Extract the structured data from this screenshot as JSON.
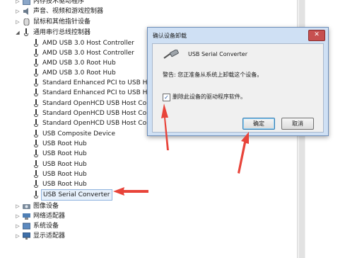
{
  "tree": {
    "top_items": [
      {
        "label": "内存技术驱动程序",
        "expander": "▷"
      },
      {
        "label": "声音、视频和游戏控制器",
        "expander": "▷"
      },
      {
        "label": "鼠标和其他指针设备",
        "expander": "▷"
      },
      {
        "label": "通用串行总线控制器",
        "expander": "◢"
      }
    ],
    "usb_children": [
      "AMD USB 3.0 Host Controller",
      "AMD USB 3.0 Host Controller",
      "AMD USB 3.0 Root Hub",
      "AMD USB 3.0 Root Hub",
      "Standard Enhanced PCI to USB Host",
      "Standard Enhanced PCI to USB Host",
      "Standard OpenHCD USB Host Contr",
      "Standard OpenHCD USB Host Contr",
      "Standard OpenHCD USB Host Contr",
      "USB Composite Device",
      "USB Root Hub",
      "USB Root Hub",
      "USB Root Hub",
      "USB Root Hub",
      "USB Root Hub",
      "USB Serial Converter"
    ],
    "bottom_items": [
      {
        "label": "图像设备",
        "expander": "▷"
      },
      {
        "label": "网络适配器",
        "expander": "▷"
      },
      {
        "label": "系统设备",
        "expander": "▷"
      },
      {
        "label": "显示适配器",
        "expander": "▷"
      }
    ]
  },
  "dialog": {
    "title": "确认设备卸载",
    "close_label": "✕",
    "device_name": "USB Serial Converter",
    "warning": "警告: 您正准备从系统上卸载这个设备。",
    "checkbox_checked": true,
    "checkbox_mark": "✓",
    "checkbox_label": "删除此设备的驱动程序软件。",
    "ok_label": "确定",
    "cancel_label": "取消"
  },
  "colors": {
    "arrow": "#e8443a",
    "selection": "#e6f0fb",
    "dialog_frame": "#cfe0f4"
  }
}
